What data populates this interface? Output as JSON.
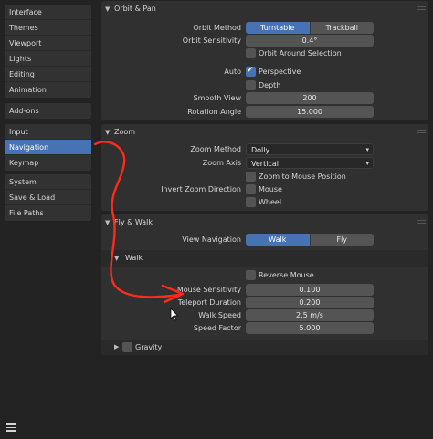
{
  "sidebar": {
    "group1": [
      "Interface",
      "Themes",
      "Viewport",
      "Lights",
      "Editing",
      "Animation"
    ],
    "group2": [
      "Add-ons"
    ],
    "group3": [
      "Input",
      "Navigation",
      "Keymap"
    ],
    "group4": [
      "System",
      "Save & Load",
      "File Paths"
    ],
    "active": "Navigation"
  },
  "orbit": {
    "header": "Orbit & Pan",
    "orbit_method_label": "Orbit Method",
    "orbit_method_options": [
      "Turntable",
      "Trackball"
    ],
    "orbit_method_selected": "Turntable",
    "orbit_sensitivity_label": "Orbit Sensitivity",
    "orbit_sensitivity_value": "0.4°",
    "orbit_around_selection": "Orbit Around Selection",
    "auto_label": "Auto",
    "perspective": "Perspective",
    "depth": "Depth",
    "smooth_view_label": "Smooth View",
    "smooth_view_value": "200",
    "rotation_angle_label": "Rotation Angle",
    "rotation_angle_value": "15.000"
  },
  "zoom": {
    "header": "Zoom",
    "zoom_method_label": "Zoom Method",
    "zoom_method_value": "Dolly",
    "zoom_axis_label": "Zoom Axis",
    "zoom_axis_value": "Vertical",
    "zoom_to_mouse": "Zoom to Mouse Position",
    "invert_label": "Invert Zoom Direction",
    "mouse": "Mouse",
    "wheel": "Wheel"
  },
  "fly": {
    "header": "Fly & Walk",
    "view_nav_label": "View Navigation",
    "view_nav_options": [
      "Walk",
      "Fly"
    ],
    "view_nav_selected": "Walk",
    "walk_header": "Walk",
    "reverse_mouse": "Reverse Mouse",
    "mouse_sens_label": "Mouse Sensitivity",
    "mouse_sens_value": "0.100",
    "teleport_label": "Teleport Duration",
    "teleport_value": "0.200",
    "walk_speed_label": "Walk Speed",
    "walk_speed_value": "2.5 m/s",
    "speed_factor_label": "Speed Factor",
    "speed_factor_value": "5.000",
    "gravity": "Gravity"
  },
  "colors": {
    "accent": "#4772b3",
    "annotation": "#ff2a1a"
  }
}
